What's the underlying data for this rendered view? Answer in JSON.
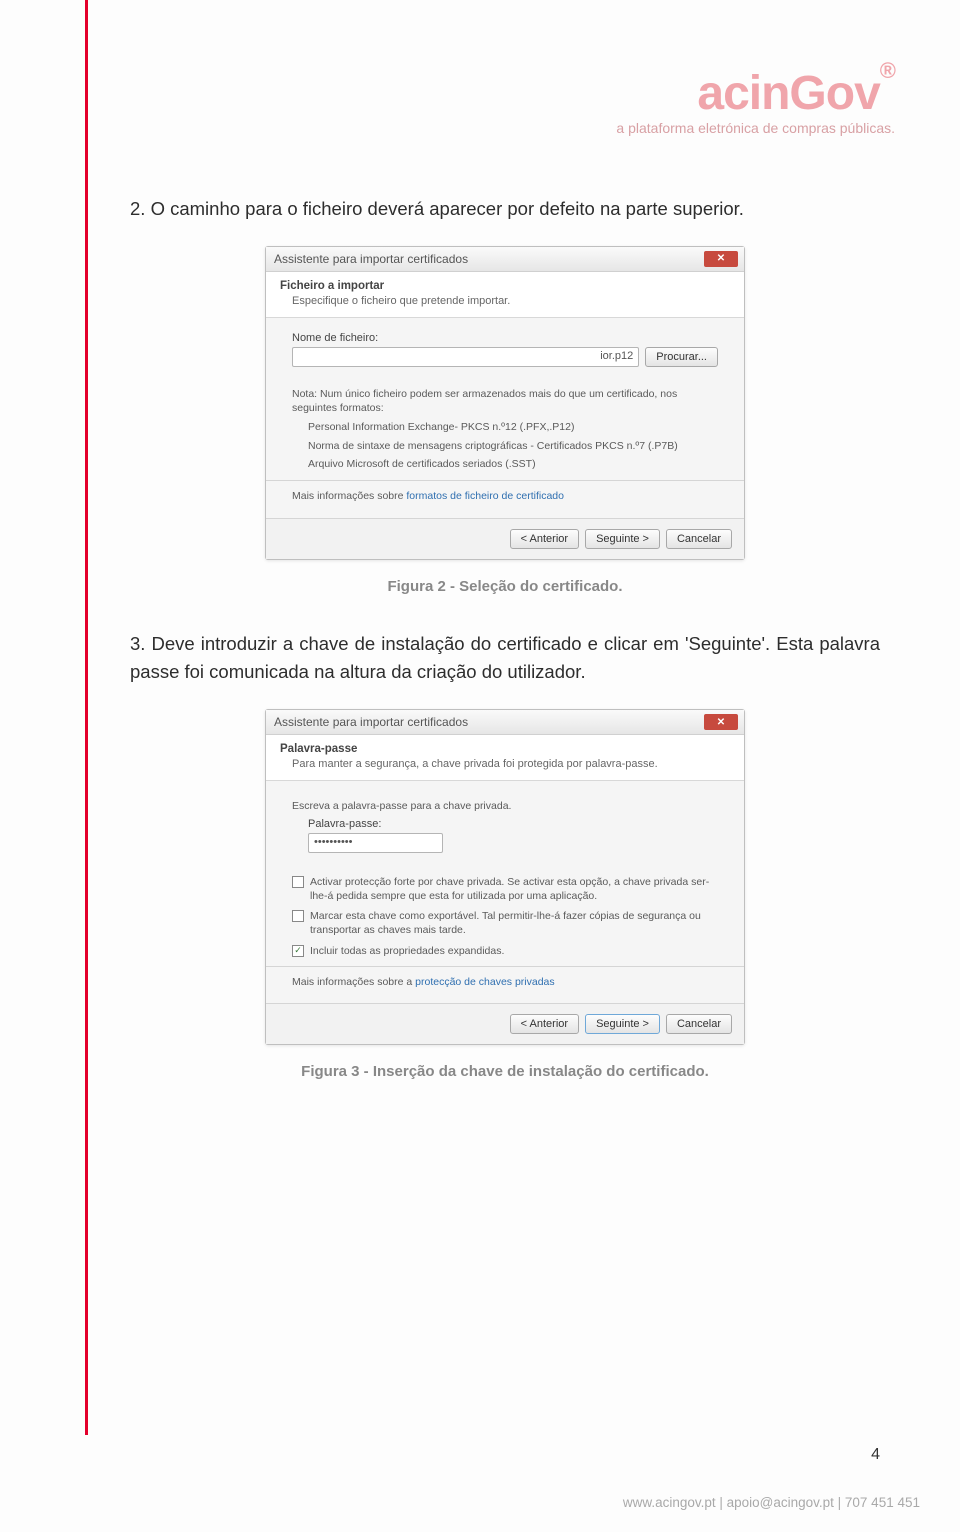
{
  "logo": {
    "name": "acinGov",
    "reg": "®",
    "tag": "a plataforma eletrónica de compras públicas."
  },
  "text": {
    "p1": "2. O caminho para o ficheiro deverá aparecer por defeito na parte superior.",
    "p2_a": "3. Deve introduzir a chave de instalação do certificado e clicar em ",
    "p2_b": "'Seguinte'. Esta palavra passe foi comunicada na altura da criação do utilizador."
  },
  "caption1": "Figura 2 - Seleção do certificado.",
  "caption2": "Figura 3 - Inserção da chave de instalação do certificado.",
  "dialog1": {
    "title": "Assistente para importar certificados",
    "heading": "Ficheiro a importar",
    "sub": "Especifique o ficheiro que pretende importar.",
    "fileLabel": "Nome de ficheiro:",
    "fileValue": "ior.p12",
    "browse": "Procurar...",
    "note": "Nota: Num único ficheiro podem ser armazenados mais do que um certificado, nos seguintes formatos:",
    "fmt1": "Personal Information Exchange- PKCS n.º12 (.PFX,.P12)",
    "fmt2": "Norma de sintaxe de mensagens criptográficas - Certificados PKCS n.º7 (.P7B)",
    "fmt3": "Arquivo Microsoft de certificados seriados (.SST)",
    "moreInfo": "Mais informações sobre ",
    "moreLink": "formatos de ficheiro de certificado",
    "back": "< Anterior",
    "next": "Seguinte >",
    "cancel": "Cancelar"
  },
  "dialog2": {
    "title": "Assistente para importar certificados",
    "heading": "Palavra-passe",
    "sub": "Para manter a segurança, a chave privada foi protegida por palavra-passe.",
    "instr": "Escreva a palavra-passe para a chave privada.",
    "pwLabel": "Palavra-passe:",
    "pwValue": "••••••••••",
    "cb1": "Activar protecção forte por chave privada. Se activar esta opção, a chave privada ser-lhe-á pedida sempre que esta for utilizada por uma aplicação.",
    "cb2": "Marcar esta chave como exportável. Tal permitir-lhe-á fazer cópias de segurança ou transportar as chaves mais tarde.",
    "cb3": "Incluir todas as propriedades expandidas.",
    "moreInfo": "Mais informações sobre a ",
    "moreLink": "protecção de chaves privadas",
    "back": "< Anterior",
    "next": "Seguinte >",
    "cancel": "Cancelar"
  },
  "pageNum": "4",
  "footer": "www.acingov.pt | apoio@acingov.pt | 707 451 451"
}
